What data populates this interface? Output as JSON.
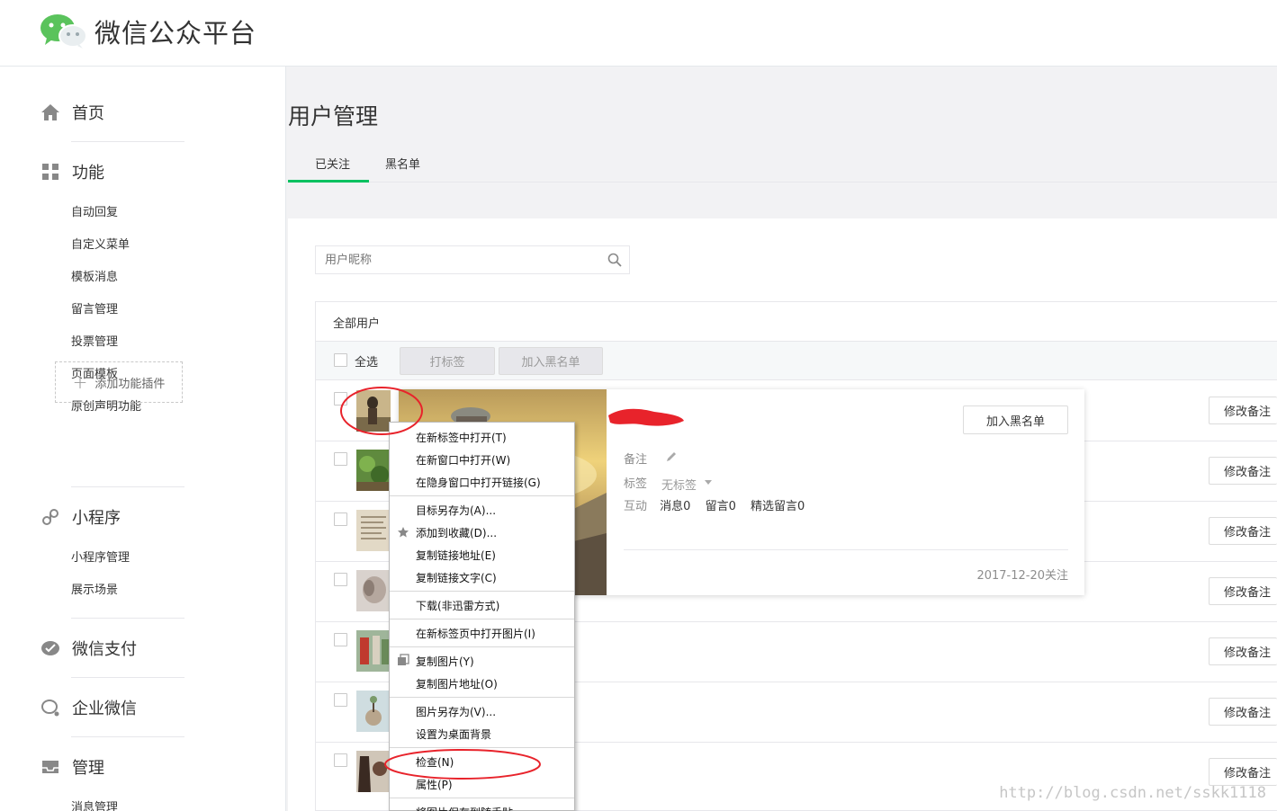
{
  "header": {
    "title": "微信公众平台",
    "logo_icon": "wechat-logo-icon"
  },
  "sidebar": {
    "sections": [
      {
        "label": "首页",
        "icon": "home-icon"
      },
      {
        "label": "功能",
        "icon": "grid-icon",
        "items": [
          "自动回复",
          "自定义菜单",
          "模板消息",
          "留言管理",
          "投票管理",
          "页面模板",
          "原创声明功能"
        ]
      },
      {
        "label": "小程序",
        "icon": "link-icon",
        "items": [
          "小程序管理",
          "展示场景"
        ]
      },
      {
        "label": "微信支付",
        "icon": "wechat-pay-icon"
      },
      {
        "label": "企业微信",
        "icon": "chat-icon"
      },
      {
        "label": "管理",
        "icon": "inbox-icon",
        "items": [
          "消息管理"
        ]
      }
    ],
    "add_plugin": "添加功能插件"
  },
  "main": {
    "title": "用户管理",
    "tabs": [
      "已关注",
      "黑名单"
    ],
    "search": {
      "placeholder": "用户昵称"
    },
    "group_label": "全部用户",
    "toolbar": {
      "select_all": "全选",
      "tag_button": "打标签",
      "blacklist_button": "加入黑名单"
    },
    "row_action": "修改备注",
    "row_count": 7
  },
  "user_card": {
    "blacklist_button": "加入黑名单",
    "remark_label": "备注",
    "tag_label": "标签",
    "tag_value": "无标签",
    "interact_label": "互动",
    "messages": "消息0",
    "comments": "留言0",
    "featured": "精选留言0",
    "follow_date": "2017-12-20关注"
  },
  "context_menu": {
    "items": [
      "在新标签中打开(T)",
      "在新窗口中打开(W)",
      "在隐身窗口中打开链接(G)",
      "目标另存为(A)...",
      "添加到收藏(D)...",
      "复制链接地址(E)",
      "复制链接文字(C)",
      "下载(非迅雷方式)",
      "在新标签页中打开图片(I)",
      "复制图片(Y)",
      "复制图片地址(O)",
      "图片另存为(V)...",
      "设置为桌面背景",
      "检查(N)",
      "属性(P)",
      "将图片保存到随手贴"
    ]
  },
  "watermark": "http://blog.csdn.net/sskk1118",
  "colors": {
    "accent": "#07c160",
    "annotation": "#e8232b"
  }
}
